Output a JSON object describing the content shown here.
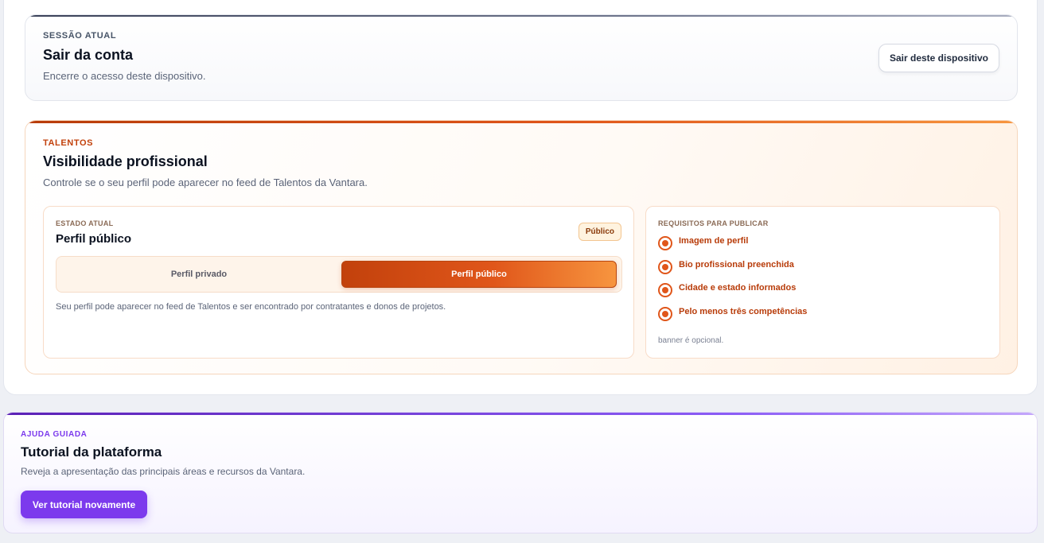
{
  "session": {
    "eyebrow": "SESSÃO ATUAL",
    "title": "Sair da conta",
    "description": "Encerre o acesso deste dispositivo.",
    "logout_button": "Sair deste dispositivo"
  },
  "talents": {
    "eyebrow": "TALENTOS",
    "title": "Visibilidade profissional",
    "description": "Controle se o seu perfil pode aparecer no feed de Talentos da Vantara.",
    "state": {
      "label": "ESTADO ATUAL",
      "value": "Perfil público",
      "badge": "Público",
      "options": {
        "private": "Perfil privado",
        "public": "Perfil público"
      },
      "selected": "public",
      "help": "Seu perfil pode aparecer no feed de Talentos e ser encontrado por contratantes e donos de projetos."
    },
    "requirements": {
      "label": "REQUISITOS PARA PUBLICAR",
      "items": [
        "Imagem de perfil",
        "Bio profissional preenchida",
        "Cidade e estado informados",
        "Pelo menos três competências"
      ],
      "note": "banner é opcional."
    },
    "accent_color": "#e0561a"
  },
  "tutorial": {
    "eyebrow": "AJUDA GUIADA",
    "title": "Tutorial da plataforma",
    "description": "Reveja a apresentação das principais áreas e recursos da Vantara.",
    "button": "Ver tutorial novamente",
    "accent_color": "#7c3aed"
  }
}
